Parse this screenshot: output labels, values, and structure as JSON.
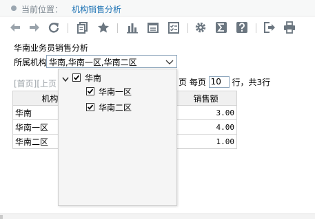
{
  "breadcrumb": {
    "label": "当前位置：",
    "value": "机构销售分析"
  },
  "toolbar": {
    "icons": [
      "back-icon",
      "forward-icon",
      "refresh-icon",
      "copy-icon",
      "favorite-icon",
      "chart-icon",
      "window-icon",
      "checklist-icon",
      "settings-icon",
      "sum-icon",
      "help-icon",
      "exit-icon",
      "print-icon"
    ]
  },
  "report": {
    "title": "华南业务员销售分析",
    "org_label": "所属机构",
    "required_mark": "*",
    "org_value": "华南,华南一区,华南二区"
  },
  "pager": {
    "left_text": "[首页][上页",
    "right_prefix": "页 每页",
    "page_size": "10",
    "right_suffix": "行，共3行"
  },
  "tree": {
    "root": {
      "label": "华南",
      "checked": true,
      "expanded": true
    },
    "children": [
      {
        "label": "华南一区",
        "checked": true
      },
      {
        "label": "华南二区",
        "checked": true
      }
    ]
  },
  "table": {
    "headers": [
      "机构",
      "",
      "销售额"
    ],
    "rows": [
      {
        "org": "华南",
        "sales": "3.00"
      },
      {
        "org": "华南一区",
        "sales": "4.00"
      },
      {
        "org": "华南二区",
        "sales": "1.00"
      }
    ]
  },
  "colors": {
    "link": "#1c72b4",
    "required": "#e60012",
    "icon": "#6b7680"
  }
}
